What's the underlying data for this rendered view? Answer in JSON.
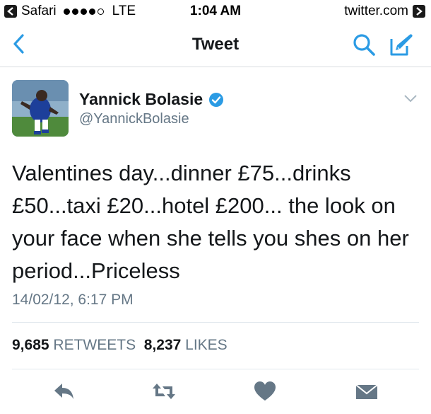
{
  "status_bar": {
    "back_app": "Safari",
    "network": "LTE",
    "time": "1:04 AM",
    "forward_app": "twitter.com",
    "signal_filled": 4,
    "signal_total": 5
  },
  "nav": {
    "title": "Tweet",
    "accent_color": "#2b9be4",
    "back_icon": "chevron-left-icon",
    "search_icon": "search-icon",
    "compose_icon": "compose-icon"
  },
  "tweet": {
    "author_name": "Yannick Bolasie",
    "author_handle": "@YannickBolasie",
    "verified": true,
    "text": "Valentines day...dinner £75...drinks £50...taxi £20...hotel £200... the look on your face when she tells you shes on her period...Priceless",
    "timestamp": "14/02/12, 6:17 PM",
    "retweets_count": "9,685",
    "retweets_label": "RETWEETS",
    "likes_count": "8,237",
    "likes_label": "LIKES"
  },
  "actions": [
    {
      "name": "reply",
      "icon": "reply-icon"
    },
    {
      "name": "retweet",
      "icon": "retweet-icon"
    },
    {
      "name": "like",
      "icon": "heart-icon"
    },
    {
      "name": "direct-message",
      "icon": "message-icon"
    }
  ]
}
